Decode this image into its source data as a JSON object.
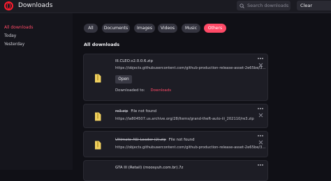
{
  "window": {
    "title": "Downloads"
  },
  "search": {
    "placeholder": "Search downloads"
  },
  "header": {
    "clear_label": "Clear"
  },
  "sidebar": {
    "items": [
      {
        "label": "All downloads",
        "active": true
      },
      {
        "label": "Today",
        "active": false
      },
      {
        "label": "Yesterday",
        "active": false
      }
    ]
  },
  "filters": [
    {
      "label": "All",
      "active": false
    },
    {
      "label": "Documents",
      "active": false
    },
    {
      "label": "Images",
      "active": false
    },
    {
      "label": "Videos",
      "active": false
    },
    {
      "label": "Music",
      "active": false
    },
    {
      "label": "Others",
      "active": true
    }
  ],
  "section": {
    "title": "All downloads"
  },
  "downloads": [
    {
      "filename": "III.CLEO.v2.0.0.6.zip",
      "url": "https://objects.githubusercontent.com/github-production-release-asset-2e65be/3...",
      "open_label": "Open",
      "downloaded_to_label": "Downloaded to:",
      "downloaded_to_value": "Downloads"
    },
    {
      "filename": "re3.zip",
      "status": "File not found",
      "url": "https://ia804507.us.archive.org/28/items/grand-theft-auto-iii_202110/re3.zip"
    },
    {
      "filename": "Ultimate-ASI-Loader (2).zip",
      "status": "File not found",
      "url": "https://objects.githubusercontent.com/github-production-release-asset-2e65be/3..."
    },
    {
      "filename": "GTA III (Retail) (moosyuh.com.br).7z"
    }
  ],
  "colors": {
    "accent": "#ff4a67",
    "background": "#101016",
    "card": "#1d1d25",
    "file_icon": "#f0d060"
  },
  "icons": {
    "app_logo": "opera-logo",
    "search": "search-icon",
    "file": "file-archive-icon",
    "more": "more-horizontal-icon",
    "close": "close-icon"
  }
}
